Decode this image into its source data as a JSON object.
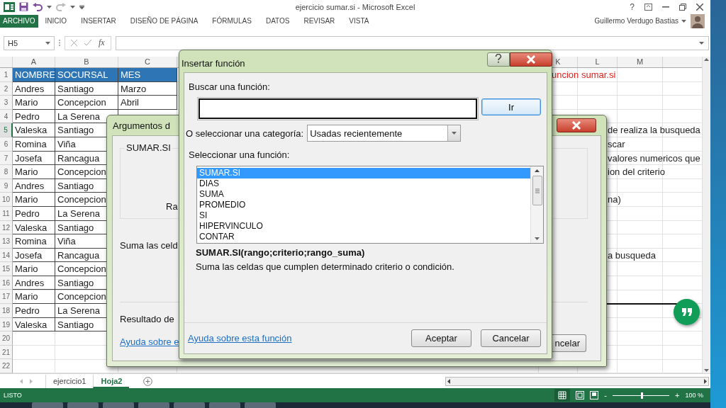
{
  "window": {
    "title": "ejercicio sumar.si - Microsoft Excel",
    "help": "?"
  },
  "ribbon": {
    "tabs": [
      {
        "label": "ARCHIVO",
        "selected": true
      },
      {
        "label": "INICIO",
        "selected": false
      },
      {
        "label": "INSERTAR",
        "selected": false
      },
      {
        "label": "DISEÑO DE PÁGINA",
        "selected": false
      },
      {
        "label": "FÓRMULAS",
        "selected": false
      },
      {
        "label": "DATOS",
        "selected": false
      },
      {
        "label": "REVISAR",
        "selected": false
      },
      {
        "label": "VISTA",
        "selected": false
      }
    ],
    "user": "Guillermo Verdugo Bastias"
  },
  "formula_bar": {
    "name_box": "H5",
    "function_label": "fx"
  },
  "sheet": {
    "columns_left": [
      "A",
      "B",
      "C"
    ],
    "columns_right": [
      "K",
      "L",
      "M"
    ],
    "rows": [
      {
        "number": "1",
        "header": true,
        "active": false,
        "rule": false,
        "cells": [
          "NOMBRE",
          "SOCURSAL",
          "MES"
        ],
        "note": {
          "kind": "title",
          "text": "uncion sumar.si"
        }
      },
      {
        "number": "2",
        "header": false,
        "active": false,
        "rule": false,
        "cells": [
          "Andres",
          "Santiago",
          "Marzo"
        ]
      },
      {
        "number": "3",
        "header": false,
        "active": false,
        "rule": false,
        "cells": [
          "Mario",
          "Concepcion",
          "Abril"
        ]
      },
      {
        "number": "4",
        "header": false,
        "active": false,
        "rule": false,
        "cells": [
          "Pedro",
          "La Serena"
        ]
      },
      {
        "number": "5",
        "header": false,
        "active": true,
        "rule": false,
        "cells": [
          "Valeska",
          "Santiago"
        ],
        "note": {
          "kind": "plain",
          "text": "de realiza la busqueda"
        }
      },
      {
        "number": "6",
        "header": false,
        "active": false,
        "rule": false,
        "cells": [
          "Romina",
          "Viña"
        ],
        "note": {
          "kind": "plain",
          "text": "scar"
        }
      },
      {
        "number": "7",
        "header": false,
        "active": false,
        "rule": false,
        "cells": [
          "Josefa",
          "Rancagua"
        ],
        "note": {
          "kind": "plain",
          "text": "valores numericos que"
        }
      },
      {
        "number": "8",
        "header": false,
        "active": false,
        "rule": false,
        "cells": [
          "Mario",
          "Concepcion"
        ],
        "note": {
          "kind": "plain",
          "text": "ion del criterio"
        }
      },
      {
        "number": "9",
        "header": false,
        "active": false,
        "rule": false,
        "cells": [
          "Andres",
          "Santiago"
        ]
      },
      {
        "number": "10",
        "header": false,
        "active": false,
        "rule": false,
        "cells": [
          "Mario",
          "Concepcion"
        ],
        "note": {
          "kind": "plain",
          "text": "na)"
        }
      },
      {
        "number": "11",
        "header": false,
        "active": false,
        "rule": false,
        "cells": [
          "Pedro",
          "La Serena"
        ]
      },
      {
        "number": "12",
        "header": false,
        "active": false,
        "rule": false,
        "cells": [
          "Valeska",
          "Santiago"
        ]
      },
      {
        "number": "13",
        "header": false,
        "active": false,
        "rule": false,
        "cells": [
          "Romina",
          "Viña"
        ]
      },
      {
        "number": "14",
        "header": false,
        "active": false,
        "rule": false,
        "cells": [
          "Josefa",
          "Rancagua"
        ],
        "note": {
          "kind": "plain",
          "text": "a busqueda"
        }
      },
      {
        "number": "15",
        "header": false,
        "active": false,
        "rule": false,
        "cells": [
          "Mario",
          "Concepcion"
        ]
      },
      {
        "number": "16",
        "header": false,
        "active": false,
        "rule": false,
        "cells": [
          "Andres",
          "Santiago"
        ]
      },
      {
        "number": "17",
        "header": false,
        "active": false,
        "rule": true,
        "cells": [
          "Mario",
          "Concepcion"
        ]
      },
      {
        "number": "18",
        "header": false,
        "active": false,
        "rule": false,
        "cells": [
          "Pedro",
          "La Serena"
        ]
      },
      {
        "number": "19",
        "header": false,
        "active": false,
        "rule": false,
        "cells": [
          "Valeska",
          "Santiago"
        ]
      },
      {
        "number": "20",
        "header": false,
        "active": false,
        "rule": false,
        "cells": []
      },
      {
        "number": "21",
        "header": false,
        "active": false,
        "rule": false,
        "cells": []
      },
      {
        "number": "22",
        "header": false,
        "active": false,
        "rule": false,
        "cells": []
      }
    ]
  },
  "arguments_dialog": {
    "title": "Argumentos d",
    "group": "SUMAR.SI",
    "field_label": "Ra",
    "description": "Suma las celd",
    "result": "Resultado de",
    "help_link": "Ayuda sobre e",
    "cancel": "ncelar"
  },
  "insert_dialog": {
    "title": "Insertar función",
    "search_label": "Buscar una función:",
    "go": "Ir",
    "category_label": "O seleccionar una categoría:",
    "category": "Usadas recientemente",
    "list_label": "Seleccionar una función:",
    "functions": [
      {
        "name": "SUMAR.SI",
        "selected": true
      },
      {
        "name": "DIAS",
        "selected": false
      },
      {
        "name": "SUMA",
        "selected": false
      },
      {
        "name": "PROMEDIO",
        "selected": false
      },
      {
        "name": "SI",
        "selected": false
      },
      {
        "name": "HIPERVINCULO",
        "selected": false
      },
      {
        "name": "CONTAR",
        "selected": false
      }
    ],
    "signature": "SUMAR.SI(rango;criterio;rango_suma)",
    "description": "Suma las celdas que cumplen determinado criterio o condición.",
    "help_link": "Ayuda sobre esta función",
    "ok": "Aceptar",
    "cancel": "Cancelar"
  },
  "sheet_tabs": [
    {
      "label": "ejercicio1",
      "selected": false
    },
    {
      "label": "Hoja2",
      "selected": true
    }
  ],
  "status_bar": {
    "status": "LISTO",
    "zoom_out": "-",
    "zoom": {
      "level": 0.5
    },
    "zoom_in": "+",
    "zoom_text": "100 %"
  }
}
